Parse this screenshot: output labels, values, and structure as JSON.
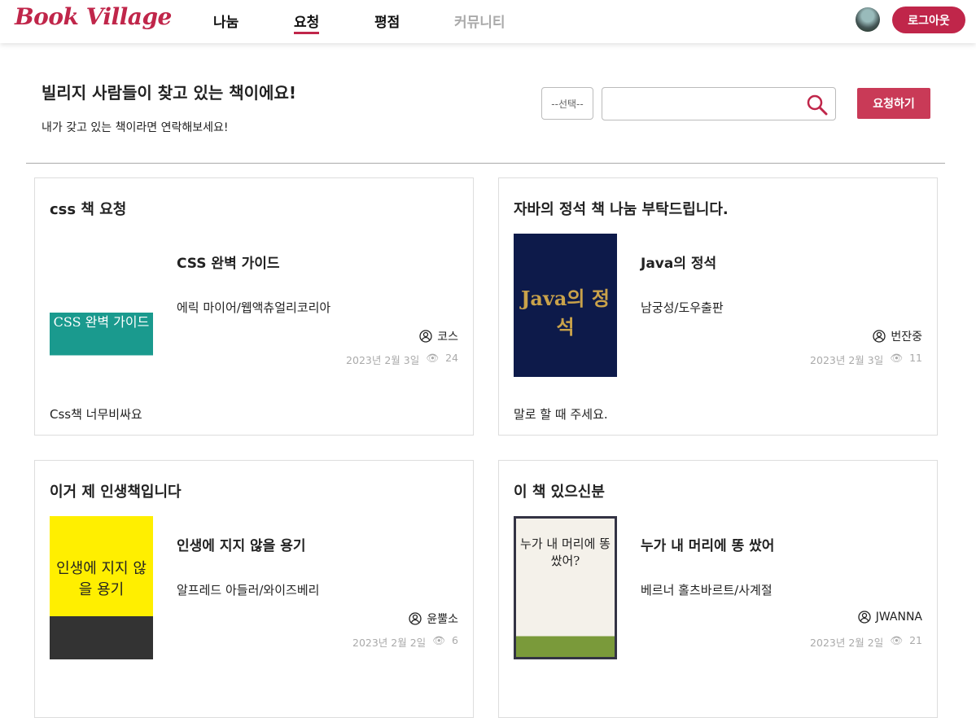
{
  "header": {
    "logo": "Book Village",
    "nav": [
      {
        "label": "나눔"
      },
      {
        "label": "요청",
        "active": true
      },
      {
        "label": "평점"
      },
      {
        "label": "커뮤니티",
        "disabled": true
      }
    ],
    "logout": "로그아웃"
  },
  "hero": {
    "title": "빌리지 사람들이 찾고 있는 책이에요!",
    "subtitle": "내가 갖고 있는 책이라면 연락해보세요!",
    "select": "--선택--",
    "search_value": "",
    "request_button": "요청하기"
  },
  "accent": "#c0264a",
  "cards": [
    {
      "title": "css 책 요청",
      "book_title": "CSS 완벽 가이드",
      "author": "에릭 마이어/웹액츄얼리코리아",
      "user": "코스",
      "date": "2023년 2월 3일",
      "views": "24",
      "comment": "Css책 너무비싸요",
      "cover_text": "CSS 완벽 가이드"
    },
    {
      "title": "자바의 정석 책 나눔 부탁드립니다.",
      "book_title": "Java의 정석",
      "author": "남궁성/도우출판",
      "user": "번잔중",
      "date": "2023년 2월 3일",
      "views": "11",
      "comment": "말로 할 때 주세요.",
      "cover_text": "Java의 정석"
    },
    {
      "title": "이거 제 인생책입니다",
      "book_title": "인생에 지지 않을 용기",
      "author": "알프레드 아들러/와이즈베리",
      "user": "윤뿔소",
      "date": "2023년 2월 2일",
      "views": "6",
      "comment": "",
      "cover_text": "인생에 지지 않을 용기"
    },
    {
      "title": "이 책 있으신분",
      "book_title": "누가 내 머리에 똥 쌌어",
      "author": "베르너 홀츠바르트/사계절",
      "user": "JWANNA",
      "date": "2023년 2월 2일",
      "views": "21",
      "comment": "",
      "cover_text": "누가 내 머리에 똥 쌌어?"
    }
  ]
}
